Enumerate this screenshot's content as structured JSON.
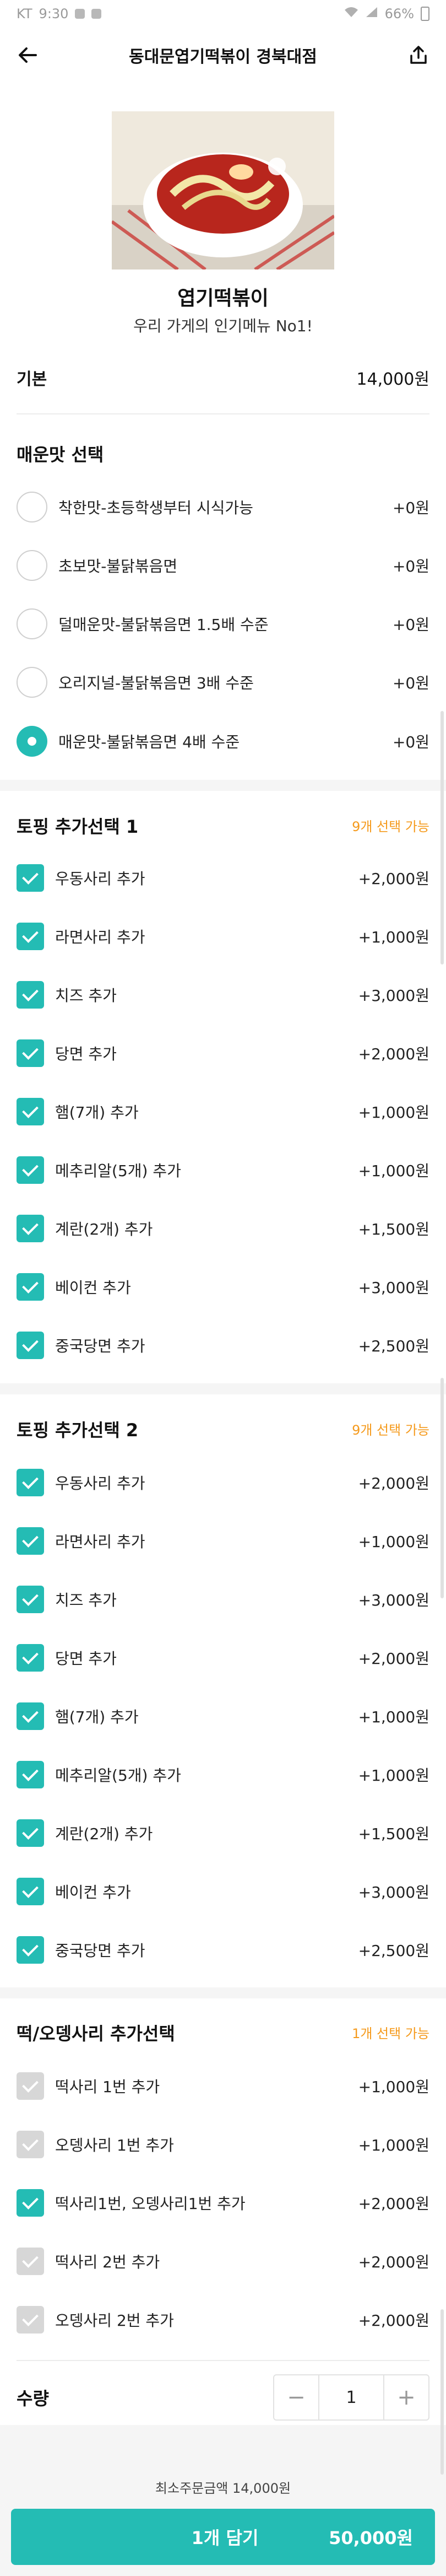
{
  "status_bar": {
    "carrier": "KT",
    "time": "9:30",
    "battery": "66%"
  },
  "header": {
    "title": "동대문엽기떡볶이 경북대점"
  },
  "product": {
    "name": "엽기떡볶이",
    "description": "우리 가게의 인기메뉴 No1!"
  },
  "base": {
    "label": "기본",
    "price": "14,000원"
  },
  "spicy": {
    "title": "매운맛 선택",
    "options": [
      {
        "label": "착한맛-초등학생부터 시식가능",
        "price": "+0원",
        "selected": false
      },
      {
        "label": "초보맛-불닭볶음면",
        "price": "+0원",
        "selected": false
      },
      {
        "label": "덜매운맛-불닭볶음면 1.5배 수준",
        "price": "+0원",
        "selected": false
      },
      {
        "label": "오리지널-불닭볶음면 3배 수준",
        "price": "+0원",
        "selected": false
      },
      {
        "label": "매운맛-불닭볶음면 4배 수준",
        "price": "+0원",
        "selected": true
      }
    ]
  },
  "topping1": {
    "title": "토핑 추가선택 1",
    "note": "9개 선택 가능",
    "options": [
      {
        "label": "우동사리 추가",
        "price": "+2,000원",
        "checked": true
      },
      {
        "label": "라면사리 추가",
        "price": "+1,000원",
        "checked": true
      },
      {
        "label": "치즈 추가",
        "price": "+3,000원",
        "checked": true
      },
      {
        "label": "당면 추가",
        "price": "+2,000원",
        "checked": true
      },
      {
        "label": "햄(7개) 추가",
        "price": "+1,000원",
        "checked": true
      },
      {
        "label": "메추리알(5개) 추가",
        "price": "+1,000원",
        "checked": true
      },
      {
        "label": "계란(2개) 추가",
        "price": "+1,500원",
        "checked": true
      },
      {
        "label": "베이컨 추가",
        "price": "+3,000원",
        "checked": true
      },
      {
        "label": "중국당면 추가",
        "price": "+2,500원",
        "checked": true
      }
    ]
  },
  "topping2": {
    "title": "토핑 추가선택 2",
    "note": "9개 선택 가능",
    "options": [
      {
        "label": "우동사리 추가",
        "price": "+2,000원",
        "checked": true
      },
      {
        "label": "라면사리 추가",
        "price": "+1,000원",
        "checked": true
      },
      {
        "label": "치즈 추가",
        "price": "+3,000원",
        "checked": true
      },
      {
        "label": "당면 추가",
        "price": "+2,000원",
        "checked": true
      },
      {
        "label": "햄(7개) 추가",
        "price": "+1,000원",
        "checked": true
      },
      {
        "label": "메추리알(5개) 추가",
        "price": "+1,000원",
        "checked": true
      },
      {
        "label": "계란(2개) 추가",
        "price": "+1,500원",
        "checked": true
      },
      {
        "label": "베이컨 추가",
        "price": "+3,000원",
        "checked": true
      },
      {
        "label": "중국당면 추가",
        "price": "+2,500원",
        "checked": true
      }
    ]
  },
  "rice_cake": {
    "title": "떡/오뎅사리 추가선택",
    "note": "1개 선택 가능",
    "options": [
      {
        "label": "떡사리 1번 추가",
        "price": "+1,000원",
        "checked": false
      },
      {
        "label": "오뎅사리 1번 추가",
        "price": "+1,000원",
        "checked": false
      },
      {
        "label": "떡사리1번, 오뎅사리1번 추가",
        "price": "+2,000원",
        "checked": true
      },
      {
        "label": "떡사리 2번 추가",
        "price": "+2,000원",
        "checked": false
      },
      {
        "label": "오뎅사리 2번 추가",
        "price": "+2,000원",
        "checked": false
      }
    ]
  },
  "quantity": {
    "label": "수량",
    "minus": "−",
    "value": "1",
    "plus": "+"
  },
  "footer": {
    "min_order": "최소주문금액 14,000원",
    "cta_label": "1개 담기",
    "cta_amount": "50,000원"
  },
  "colors": {
    "accent": "#24bcb4",
    "note": "#f59a1c"
  }
}
